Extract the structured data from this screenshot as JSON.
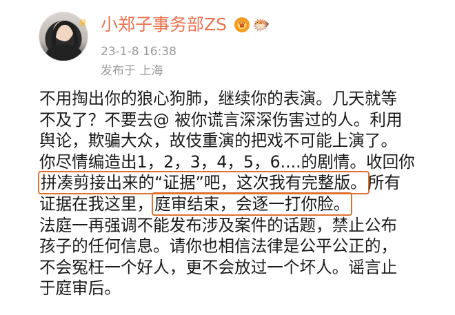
{
  "post": {
    "username": "小郑子事务部ZS",
    "badges": {
      "vip_icon": "crown-icon",
      "fish_icon": "fish-icon",
      "vip_glyph": "♛",
      "fish_glyph": "🐡",
      "avatar_crown_glyph": "♛"
    },
    "timestamp": "23-1-8 16:38",
    "location": "发布于 上海",
    "highlight_color": "#e0702e",
    "username_color": "#eb7350",
    "lines": [
      {
        "a": "不用掏出你的狼心狗肺，继续你的表演。几天就等"
      },
      {
        "a": "不及了？不要去@ 被你谎言深深伤害过的人。利用"
      },
      {
        "a": "舆论，欺骗大众，故伎重演的把戏不可能上演了。"
      },
      {
        "a": "你尽情编造出1，2，3，4，5，6....的剧情。收回你"
      },
      {
        "hl": "拼凑剪接出来的“证据”吧，这次我有完整版。",
        "b": "所有"
      },
      {
        "a": "证据在我这里，",
        "hl": "庭审结束，会逐一打你脸。"
      },
      {
        "a": "法庭一再强调不能发布涉及案件的话题，禁止公布"
      },
      {
        "a": "孩子的任何信息。请你也相信法律是公平公正的，"
      },
      {
        "a": "不会冤枉一个好人，更不会放过一个坏人。谣言止"
      },
      {
        "a": "于庭审后。"
      }
    ]
  }
}
